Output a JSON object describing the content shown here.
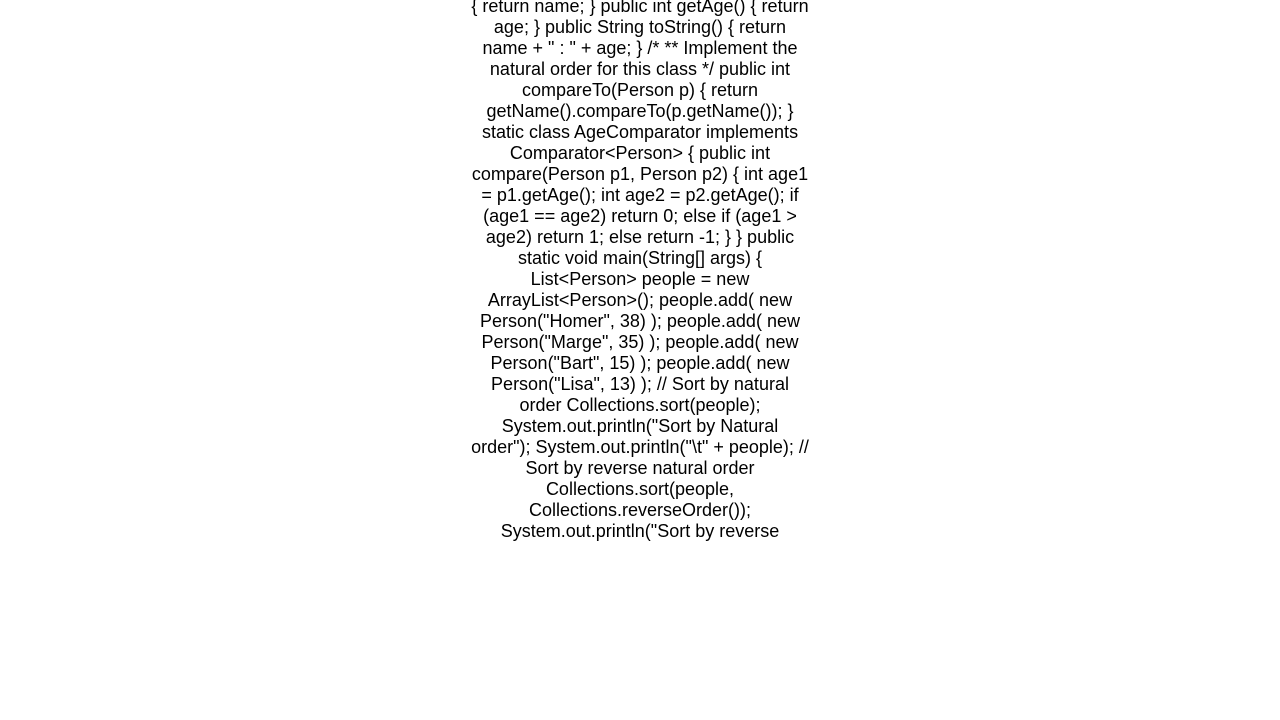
{
  "code_text": "{         return name;     }      public int getAge()     {         return age;     }      public String toString()     {         return name + \" : \" + age;     }      /*     **  Implement the natural order for this class     */     public int compareTo(Person p)     {         return getName().compareTo(p.getName());     }      static class AgeComparator implements Comparator<Person>     {         public int compare(Person p1, Person p2)         {             int age1 = p1.getAge();             int age2 = p2.getAge();              if (age1 == age2)                 return 0;             else if (age1 > age2)                 return 1;             else                 return -1;         }     }      public static void main(String[] args)     {         List<Person> people = new ArrayList<Person>();         people.add( new Person(\"Homer\", 38) );         people.add( new Person(\"Marge\", 35) );         people.add( new Person(\"Bart\", 15) );         people.add( new Person(\"Lisa\", 13) );          // Sort by natural order          Collections.sort(people);         System.out.println(\"Sort by Natural order\");         System.out.println(\"\\t\" + people);          // Sort by reverse natural order          Collections.sort(people, Collections.reverseOrder());         System.out.println(\"Sort by reverse"
}
